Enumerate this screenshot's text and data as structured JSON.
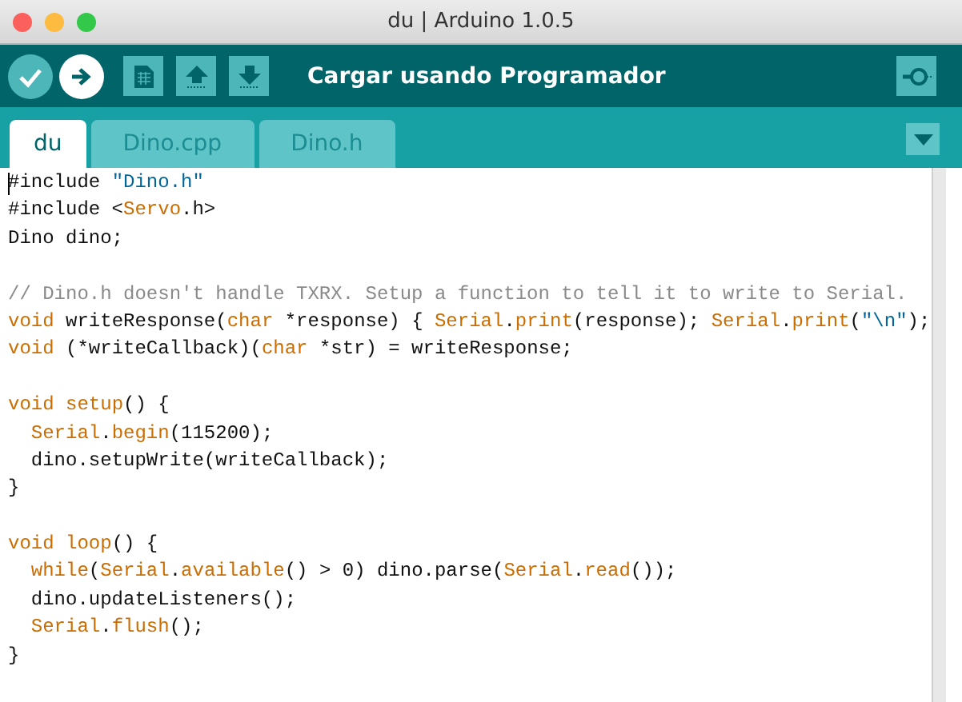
{
  "window": {
    "title": "du | Arduino 1.0.5"
  },
  "toolbar": {
    "buttons": [
      {
        "kind": "verify",
        "highlighted": false
      },
      {
        "kind": "upload",
        "highlighted": true
      },
      {
        "kind": "new",
        "highlighted": false
      },
      {
        "kind": "open",
        "highlighted": false
      },
      {
        "kind": "save",
        "highlighted": false
      }
    ],
    "status": "Cargar usando Programador"
  },
  "tabs": [
    {
      "label": "du",
      "selected": true
    },
    {
      "label": "Dino.cpp",
      "selected": false
    },
    {
      "label": "Dino.h",
      "selected": false
    }
  ],
  "editor": {
    "lines": [
      {
        "cursor": true,
        "tokens": [
          {
            "t": "#include ",
            "kind": "plain"
          },
          {
            "t": "\"Dino.h\"",
            "kind": "str"
          }
        ]
      },
      {
        "tokens": [
          {
            "t": "#include <",
            "kind": "plain"
          },
          {
            "t": "Servo",
            "kind": "kw"
          },
          {
            "t": ".h>",
            "kind": "plain"
          }
        ]
      },
      {
        "tokens": [
          {
            "t": "Dino dino;",
            "kind": "plain"
          }
        ]
      },
      {
        "kind": "blank"
      },
      {
        "tokens": [
          {
            "t": "// Dino.h doesn't handle TXRX. Setup a function to tell it to write to Serial.",
            "kind": "cmt"
          }
        ]
      },
      {
        "tokens": [
          {
            "t": "void",
            "kind": "kw"
          },
          {
            "t": " writeResponse(",
            "kind": "plain"
          },
          {
            "t": "char",
            "kind": "kw"
          },
          {
            "t": " *response) { ",
            "kind": "plain"
          },
          {
            "t": "Serial",
            "kind": "kw"
          },
          {
            "t": ".",
            "kind": "plain"
          },
          {
            "t": "print",
            "kind": "kw"
          },
          {
            "t": "(response); ",
            "kind": "plain"
          },
          {
            "t": "Serial",
            "kind": "kw"
          },
          {
            "t": ".",
            "kind": "plain"
          },
          {
            "t": "print",
            "kind": "kw"
          },
          {
            "t": "(",
            "kind": "plain"
          },
          {
            "t": "\"\\n\"",
            "kind": "str"
          },
          {
            "t": ");",
            "kind": "plain"
          }
        ]
      },
      {
        "tokens": [
          {
            "t": "void",
            "kind": "kw"
          },
          {
            "t": " (*writeCallback)(",
            "kind": "plain"
          },
          {
            "t": "char",
            "kind": "kw"
          },
          {
            "t": " *str) = writeResponse;",
            "kind": "plain"
          }
        ]
      },
      {
        "kind": "blank"
      },
      {
        "tokens": [
          {
            "t": "void",
            "kind": "kw"
          },
          {
            "t": " setup",
            "kind": "kw"
          },
          {
            "t": "() {",
            "kind": "plain"
          }
        ]
      },
      {
        "tokens": [
          {
            "t": "  Serial",
            "kind": "kw"
          },
          {
            "t": ".",
            "kind": "plain"
          },
          {
            "t": "begin",
            "kind": "kw"
          },
          {
            "t": "(115200);",
            "kind": "plain"
          }
        ]
      },
      {
        "tokens": [
          {
            "t": "  dino.setupWrite(writeCallback);",
            "kind": "plain"
          }
        ]
      },
      {
        "tokens": [
          {
            "t": "}",
            "kind": "plain"
          }
        ]
      },
      {
        "kind": "blank"
      },
      {
        "tokens": [
          {
            "t": "void",
            "kind": "kw"
          },
          {
            "t": " loop",
            "kind": "kw"
          },
          {
            "t": "() {",
            "kind": "plain"
          }
        ]
      },
      {
        "tokens": [
          {
            "t": "  while",
            "kind": "kw"
          },
          {
            "t": "(",
            "kind": "plain"
          },
          {
            "t": "Serial",
            "kind": "kw"
          },
          {
            "t": ".",
            "kind": "plain"
          },
          {
            "t": "available",
            "kind": "kw"
          },
          {
            "t": "() > 0) dino.parse(",
            "kind": "plain"
          },
          {
            "t": "Serial",
            "kind": "kw"
          },
          {
            "t": ".",
            "kind": "plain"
          },
          {
            "t": "read",
            "kind": "kw"
          },
          {
            "t": "());",
            "kind": "plain"
          }
        ]
      },
      {
        "tokens": [
          {
            "t": "  dino.updateListeners();",
            "kind": "plain"
          }
        ]
      },
      {
        "tokens": [
          {
            "t": "  Serial",
            "kind": "kw"
          },
          {
            "t": ".",
            "kind": "plain"
          },
          {
            "t": "flush",
            "kind": "kw"
          },
          {
            "t": "();",
            "kind": "plain"
          }
        ]
      },
      {
        "tokens": [
          {
            "t": "}",
            "kind": "plain"
          }
        ]
      }
    ]
  }
}
